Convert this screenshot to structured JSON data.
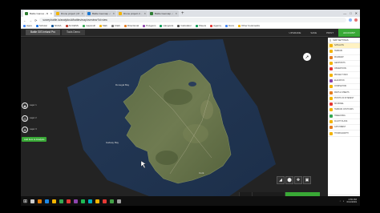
{
  "browser": {
    "tabs": [
      {
        "title": "Battle Games - Maritime &...",
        "color": "#2e7d32",
        "active": true
      },
      {
        "title": "Drone project | Mapping...",
        "color": "#f4b400",
        "active": false
      },
      {
        "title": "Battle Geomap - Earthgolo...",
        "color": "#1976d2",
        "active": false
      },
      {
        "title": "Drone project 2 - Mapping...",
        "color": "#f4b400",
        "active": false
      },
      {
        "title": "Battle Geomap - GIS Tools",
        "color": "#2e7d32",
        "active": false
      }
    ],
    "new_tab": "+",
    "window_controls": [
      "—",
      "□",
      "✕"
    ],
    "back": "←",
    "forward": "→",
    "reload": "⟳",
    "url": "survey.battle.io/analytics/#/battles/map/overview?id=view",
    "bookmarks": [
      {
        "label": "Apps",
        "color": "#4285f4"
      },
      {
        "label": "Scholar",
        "color": "#1a73e8"
      },
      {
        "label": "NOAA",
        "color": "#0b5394"
      },
      {
        "label": "ACCESS",
        "color": "#c0392b"
      },
      {
        "label": "mapsnull",
        "color": "#34a853"
      },
      {
        "label": "Slab",
        "color": "#f4b400"
      },
      {
        "label": "Clark",
        "color": "#777777"
      },
      {
        "label": "Directional",
        "color": "#e67e22"
      },
      {
        "label": "Polygons",
        "color": "#8e44ad"
      },
      {
        "label": "Hangouts",
        "color": "#0f9d58"
      },
      {
        "label": "Calculator",
        "color": "#555555"
      },
      {
        "label": "Sheets",
        "color": "#0f9d58"
      },
      {
        "label": "Agency",
        "color": "#e53935"
      },
      {
        "label": "Docs",
        "color": "#4285f4"
      },
      {
        "label": "Other bookmarks",
        "color": "#f4b400"
      }
    ]
  },
  "app": {
    "tabs": [
      {
        "label": "Battle GIS Ireland Pro",
        "active": true
      },
      {
        "label": "Tools Demo",
        "active": false
      }
    ],
    "header_buttons": [
      {
        "label": "UPGRADE",
        "green": false
      },
      {
        "label": "SAVE",
        "green": false
      },
      {
        "label": "PRINT",
        "green": false
      },
      {
        "label": "ACCOUNT",
        "green": true
      }
    ]
  },
  "map": {
    "place_labels": [
      {
        "text": "Donegal Bay"
      },
      {
        "text": "Galway Bay"
      },
      {
        "text": "Cork"
      }
    ],
    "left_controls": [
      {
        "label": "Layer 1",
        "icon": "◉"
      },
      {
        "label": "Layer 2",
        "icon": "◎"
      },
      {
        "label": "Layer 3",
        "icon": "⊕"
      }
    ],
    "add_button": "Add Item to Analysis",
    "compass": "➚",
    "tools": [
      "◢",
      "⬤",
      "✥",
      "▣"
    ]
  },
  "bottom_bar": {
    "zoom_icon": "9",
    "info_icon": "i",
    "info_label": "INFORMATION",
    "strategy_icon": "◈",
    "strategy_label": "STRATEGY"
  },
  "sidebar": {
    "menu_icon": "≡",
    "title": "MAP SETTINGS",
    "items": [
      {
        "label": "SATELLITE",
        "color": "#f4b400",
        "active": true
      },
      {
        "label": "TERRAIN",
        "color": "#f4b400",
        "active": false
      },
      {
        "label": "ROADMAP",
        "color": "#e67e22",
        "active": false
      },
      {
        "label": "GEOPOINTS",
        "color": "#f4b400",
        "active": false
      },
      {
        "label": "OPERATIONS",
        "color": "#e53935",
        "active": false
      },
      {
        "label": "PROJECT INFO",
        "color": "#f4b400",
        "active": false
      },
      {
        "label": "ELEVATION",
        "color": "#8e44ad",
        "active": false
      },
      {
        "label": "COMPLETION",
        "color": "#f4b400",
        "active": false
      },
      {
        "label": "MAPS & SHEETS",
        "color": "#e67e22",
        "active": false
      },
      {
        "label": "POINTS OF INTEREST",
        "color": "#f4b400",
        "active": false
      },
      {
        "label": "3D MODEL",
        "color": "#e53935",
        "active": false
      },
      {
        "label": "TERRAIN CONTOURS",
        "color": "#f4b400",
        "active": false
      },
      {
        "label": "TREELINING",
        "color": "#34a853",
        "active": false
      },
      {
        "label": "FLIGHT PLANS",
        "color": "#f4b400",
        "active": false
      },
      {
        "label": "CATCHMENT",
        "color": "#e67e22",
        "active": false
      },
      {
        "label": "HYDROGRAPHY",
        "color": "#f4b400",
        "active": false
      }
    ],
    "footer": [
      {
        "label": "OBJECT MANAGER",
        "color": "#f4b400"
      },
      {
        "label": "PROJECT SETTINGS",
        "color": "#777777"
      }
    ]
  },
  "taskbar": {
    "start": "⊞",
    "apps": [
      {
        "color": "#cccccc"
      },
      {
        "color": "#e57c00"
      },
      {
        "color": "#1e88e5"
      },
      {
        "color": "#f4b400"
      },
      {
        "color": "#34a853"
      },
      {
        "color": "#e53935"
      },
      {
        "color": "#8e44ad"
      },
      {
        "color": "#1db954"
      },
      {
        "color": "#00acc1"
      },
      {
        "color": "#f4b400"
      },
      {
        "color": "#e53935"
      },
      {
        "color": "#43a047"
      },
      {
        "color": "#9e9e9e"
      }
    ],
    "time": "2:55 PM",
    "date": "6/14/2019"
  }
}
